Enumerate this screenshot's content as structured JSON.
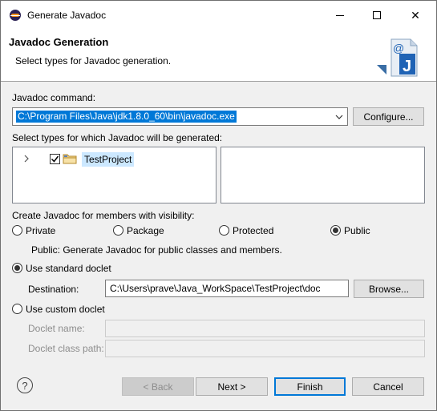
{
  "window": {
    "title": "Generate Javadoc",
    "minimize_glyph": "",
    "maximize_glyph": "",
    "close_glyph": "✕"
  },
  "header": {
    "title": "Javadoc Generation",
    "description": "Select types for Javadoc generation."
  },
  "javadoc_command": {
    "label": "Javadoc command:",
    "value": "C:\\Program Files\\Java\\jdk1.8.0_60\\bin\\javadoc.exe",
    "configure_button": "Configure..."
  },
  "types": {
    "label": "Select types for which Javadoc will be generated:",
    "project_name": "TestProject",
    "project_checked": true
  },
  "visibility": {
    "label": "Create Javadoc for members with visibility:",
    "options": [
      {
        "label": "Private",
        "checked": false
      },
      {
        "label": "Package",
        "checked": false
      },
      {
        "label": "Protected",
        "checked": false
      },
      {
        "label": "Public",
        "checked": true
      }
    ],
    "description": "Public: Generate Javadoc for public classes and members."
  },
  "standard_doclet": {
    "label": "Use standard doclet",
    "checked": true,
    "destination_label": "Destination:",
    "destination_value": "C:\\Users\\prave\\Java_WorkSpace\\TestProject\\doc",
    "browse_button": "Browse..."
  },
  "custom_doclet": {
    "label": "Use custom doclet",
    "checked": false,
    "doclet_name_label": "Doclet name:",
    "doclet_name_value": "",
    "doclet_class_path_label": "Doclet class path:",
    "doclet_class_path_value": ""
  },
  "footer": {
    "help_glyph": "?",
    "back_button": "< Back",
    "next_button": "Next >",
    "finish_button": "Finish",
    "cancel_button": "Cancel"
  },
  "colors": {
    "selection": "#0078d7",
    "tree_selection": "#cce8ff",
    "button_face": "#e1e1e1",
    "dialog_bg": "#f0f0f0"
  }
}
